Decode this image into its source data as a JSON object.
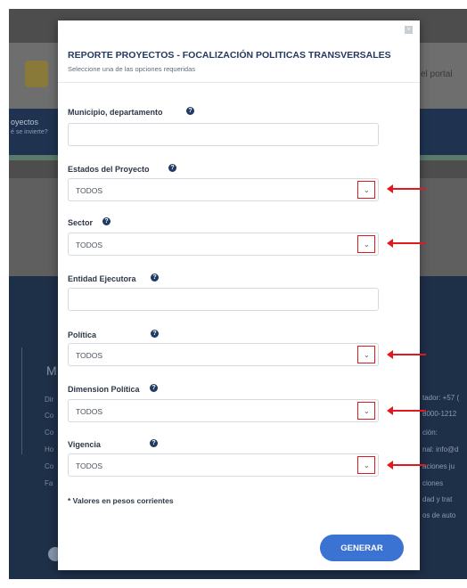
{
  "background": {
    "portal_text": "el portal",
    "nav_text_1": "oyectos",
    "nav_text_2": "é se invierte?",
    "footer_letter": "M",
    "footer_left": [
      "Dir",
      "Co",
      "Co",
      "Ho",
      "Co",
      "Fa"
    ],
    "footer_right": [
      "tador: +57 (",
      "8000-1212",
      "ción:",
      "nal: info@d",
      "aciones ju",
      "ciones",
      "dad y trat",
      "os de auto"
    ]
  },
  "modal": {
    "close_label": "×",
    "title": "REPORTE PROYECTOS - FOCALIZACIÓN POLITICAS TRANSVERSALES",
    "subtitle": "Seleccione una de las opciones requeridas",
    "help_glyph": "?",
    "caret_glyph": "⌄",
    "fields": {
      "municipio": {
        "label": "Municipio, departamento",
        "value": "",
        "placeholder": ""
      },
      "estados": {
        "label": "Estados del Proyecto",
        "value": "TODOS"
      },
      "sector": {
        "label": "Sector",
        "value": "TODOS"
      },
      "entidad": {
        "label": "Entidad Ejecutora",
        "value": "",
        "placeholder": ""
      },
      "politica": {
        "label": "Política",
        "value": "TODOS"
      },
      "dimension": {
        "label": "Dimension Política",
        "value": "TODOS"
      },
      "vigencia": {
        "label": "Vigencia",
        "value": "TODOS"
      }
    },
    "note": "* Valores en pesos corrientes",
    "generate_label": "GENERAR"
  },
  "colors": {
    "accent": "#3a73d1",
    "title": "#243a5e",
    "annotation": "#e0191f"
  }
}
